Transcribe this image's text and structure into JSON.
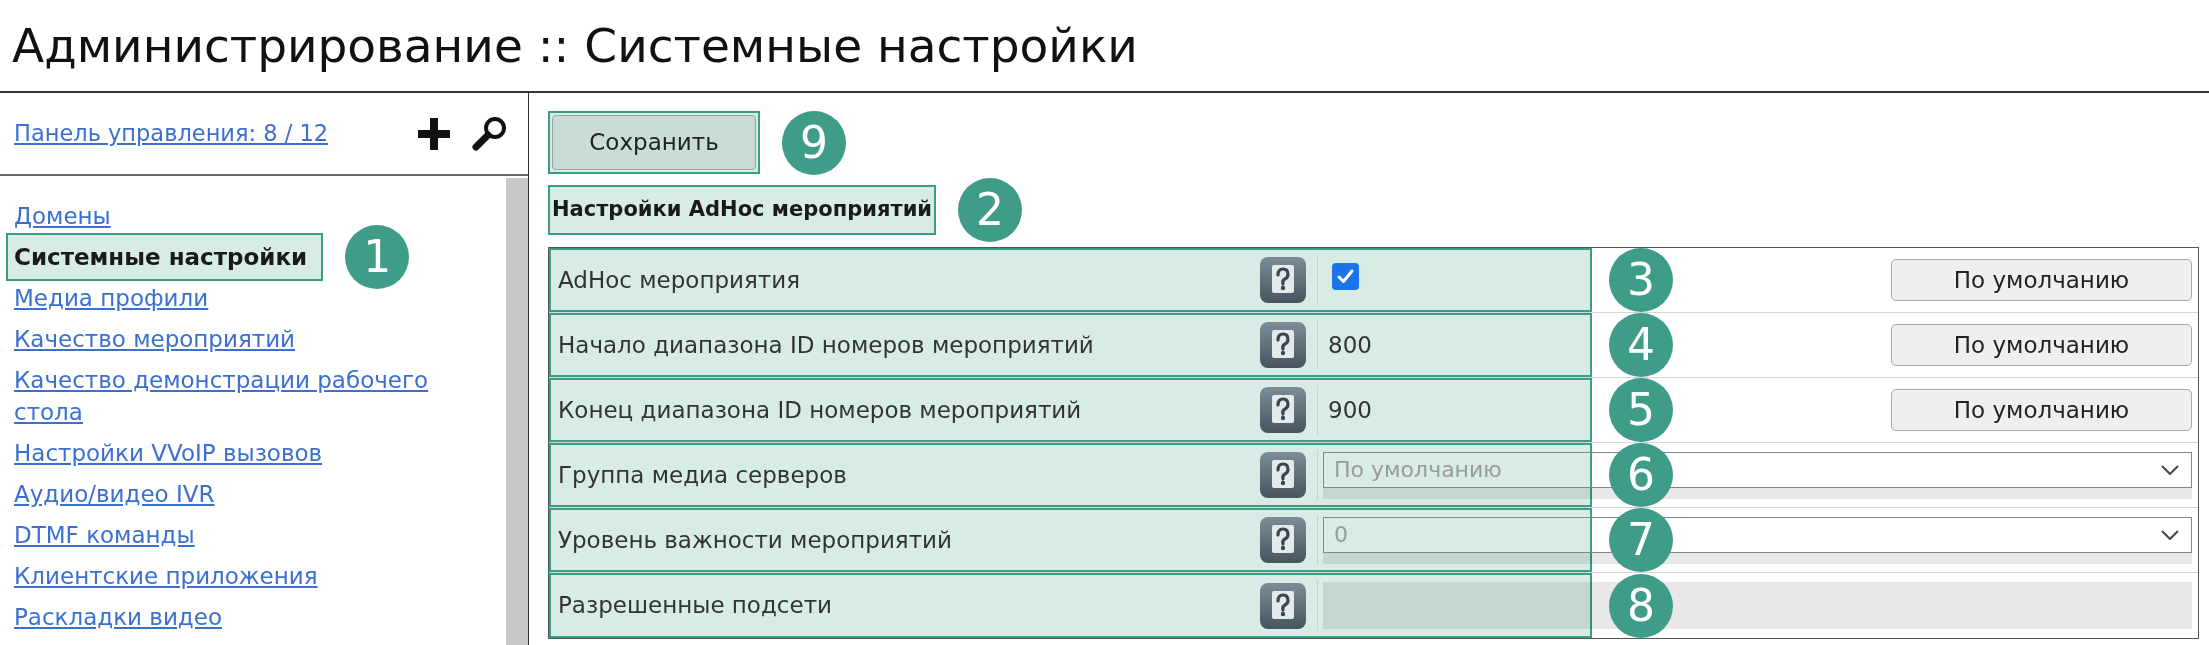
{
  "page": {
    "title": "Администрирование :: Системные настройки"
  },
  "sidebar": {
    "header_link": "Панель управления: 8 / 12",
    "items": [
      {
        "label": "Домены",
        "selected": false
      },
      {
        "label": "Системные настройки",
        "selected": true,
        "marker": "1"
      },
      {
        "label": "Медиа профили",
        "selected": false
      },
      {
        "label": "Качество мероприятий",
        "selected": false
      },
      {
        "label": "Качество демонстрации рабочего стола",
        "selected": false
      },
      {
        "label": "Настройки VVoIP вызовов",
        "selected": false
      },
      {
        "label": "Аудио/видео IVR",
        "selected": false
      },
      {
        "label": "DTMF команды",
        "selected": false
      },
      {
        "label": "Клиентские приложения",
        "selected": false
      },
      {
        "label": "Раскладки видео",
        "selected": false
      }
    ]
  },
  "toolbar": {
    "save_button": "Сохранить",
    "marker": "9"
  },
  "section": {
    "title": "Настройки AdHoc мероприятий",
    "marker": "2"
  },
  "settings": [
    {
      "kind": "checkbox",
      "label": "AdHoc мероприятия",
      "checked": true,
      "reset_button": "По умолчанию",
      "marker": "3"
    },
    {
      "kind": "number",
      "label": "Начало диапазона ID номеров мероприятий",
      "value": "800",
      "reset_button": "По умолчанию",
      "marker": "4"
    },
    {
      "kind": "number",
      "label": "Конец диапазона ID номеров мероприятий",
      "value": "900",
      "reset_button": "По умолчанию",
      "marker": "5"
    },
    {
      "kind": "select",
      "label": "Группа медиа серверов",
      "value": "По умолчанию",
      "disabled": true,
      "marker": "6"
    },
    {
      "kind": "select",
      "label": "Уровень важности мероприятий",
      "value": "0",
      "disabled": true,
      "marker": "7"
    },
    {
      "kind": "text",
      "label": "Разрешенные подсети",
      "disabled": true,
      "marker": "8"
    }
  ]
}
